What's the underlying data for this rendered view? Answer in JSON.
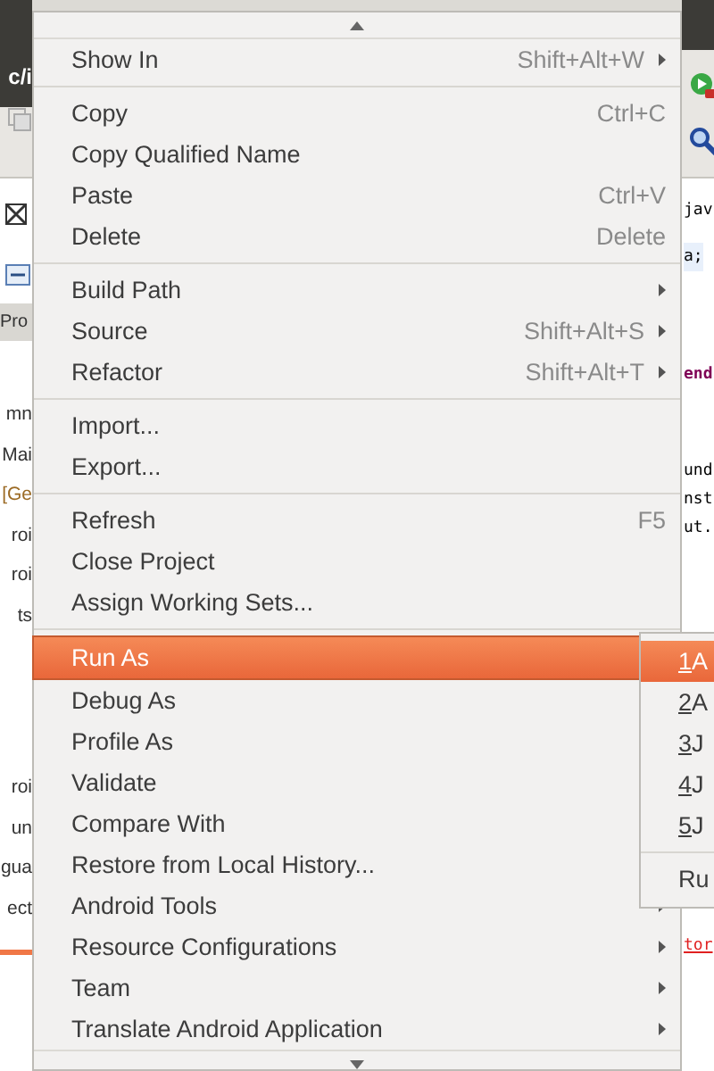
{
  "background": {
    "left_lines": [
      {
        "text": "mn",
        "kind": "plain"
      },
      {
        "text": "Mai",
        "kind": "plain"
      },
      {
        "text": "[Ge",
        "kind": "decorated"
      },
      {
        "text": "roi",
        "kind": "plain"
      },
      {
        "text": "roi",
        "kind": "plain"
      },
      {
        "text": "ts",
        "kind": "plain"
      },
      {
        "text": "roi",
        "kind": "gap"
      },
      {
        "text": "un",
        "kind": "plain"
      },
      {
        "text": "gua",
        "kind": "plain"
      },
      {
        "text": "ect",
        "kind": "plain"
      }
    ],
    "left_title": "c/i",
    "left_tab": "Pro",
    "right_lines": [
      {
        "text": "jav",
        "kind": "plain"
      },
      {
        "text": "a;",
        "kind": "highlight"
      },
      {
        "text": "end",
        "kind": "keyword"
      },
      {
        "text": "und",
        "kind": "gap"
      },
      {
        "text": "nst",
        "kind": "plain"
      },
      {
        "text": "ut.",
        "kind": "plain"
      },
      {
        "text": "tor",
        "kind": "error"
      }
    ]
  },
  "menu": {
    "items": [
      {
        "kind": "item",
        "label": "Show In",
        "shortcut": "Shift+Alt+W",
        "submenu": true,
        "selected": false
      },
      {
        "kind": "separator"
      },
      {
        "kind": "item",
        "label": "Copy",
        "shortcut": "Ctrl+C",
        "submenu": false,
        "selected": false
      },
      {
        "kind": "item",
        "label": "Copy Qualified Name",
        "submenu": false,
        "selected": false
      },
      {
        "kind": "item",
        "label": "Paste",
        "shortcut": "Ctrl+V",
        "submenu": false,
        "selected": false
      },
      {
        "kind": "item",
        "label": "Delete",
        "shortcut": "Delete",
        "submenu": false,
        "selected": false
      },
      {
        "kind": "separator"
      },
      {
        "kind": "item",
        "label": "Build Path",
        "submenu": true,
        "selected": false
      },
      {
        "kind": "item",
        "label": "Source",
        "shortcut": "Shift+Alt+S",
        "submenu": true,
        "selected": false
      },
      {
        "kind": "item",
        "label": "Refactor",
        "shortcut": "Shift+Alt+T",
        "submenu": true,
        "selected": false
      },
      {
        "kind": "separator"
      },
      {
        "kind": "item",
        "label": "Import...",
        "submenu": false,
        "selected": false
      },
      {
        "kind": "item",
        "label": "Export...",
        "submenu": false,
        "selected": false
      },
      {
        "kind": "separator"
      },
      {
        "kind": "item",
        "label": "Refresh",
        "shortcut": "F5",
        "submenu": false,
        "selected": false
      },
      {
        "kind": "item",
        "label": "Close Project",
        "submenu": false,
        "selected": false
      },
      {
        "kind": "item",
        "label": "Assign Working Sets...",
        "submenu": false,
        "selected": false
      },
      {
        "kind": "separator"
      },
      {
        "kind": "item",
        "label": "Run As",
        "submenu": true,
        "selected": true
      },
      {
        "kind": "item",
        "label": "Debug As",
        "selected": false
      },
      {
        "kind": "item",
        "label": "Profile As",
        "selected": false
      },
      {
        "kind": "item",
        "label": "Validate",
        "selected": false
      },
      {
        "kind": "item",
        "label": "Compare With",
        "selected": false
      },
      {
        "kind": "item",
        "label": "Restore from Local History...",
        "selected": false
      },
      {
        "kind": "item",
        "label": "Android Tools",
        "submenu": true,
        "selected": false
      },
      {
        "kind": "item",
        "label": "Resource Configurations",
        "submenu": true,
        "selected": false
      },
      {
        "kind": "item",
        "label": "Team",
        "submenu": true,
        "selected": false
      },
      {
        "kind": "item",
        "label": "Translate Android Application",
        "submenu": true,
        "selected": false
      }
    ]
  },
  "submenu": {
    "items": [
      {
        "kind": "item",
        "key": "1",
        "label": "A",
        "selected": true
      },
      {
        "kind": "item",
        "key": "2",
        "label": "A",
        "selected": false
      },
      {
        "kind": "item",
        "key": "3",
        "label": "J",
        "selected": false
      },
      {
        "kind": "item",
        "key": "4",
        "label": "J",
        "selected": false
      },
      {
        "kind": "item",
        "key": "5",
        "label": "J",
        "selected": false
      },
      {
        "kind": "separator"
      },
      {
        "kind": "item",
        "label": "Ru",
        "selected": false
      }
    ]
  }
}
